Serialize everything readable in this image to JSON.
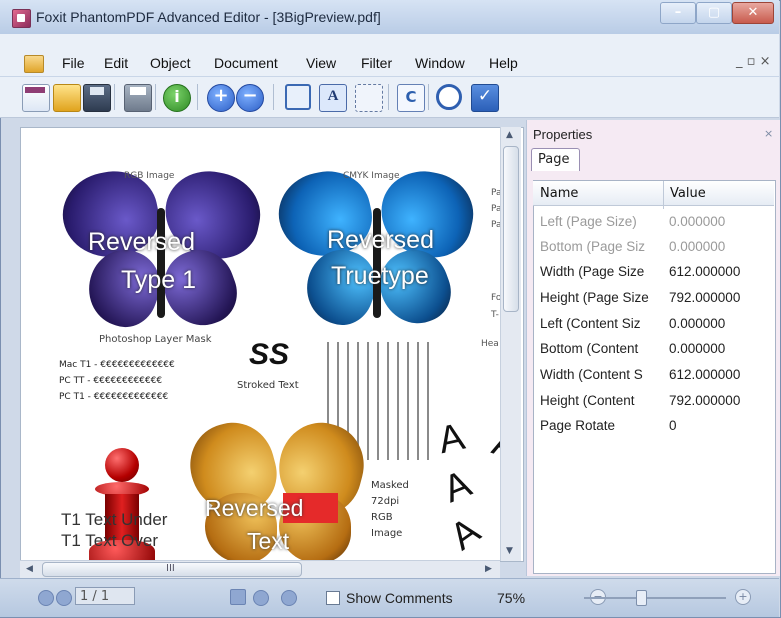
{
  "window": {
    "title": "Foxit PhantomPDF Advanced Editor - [3BigPreview.pdf]",
    "controls": {
      "minimize": "–",
      "maximize": "▢",
      "close": "✕"
    }
  },
  "menubar": {
    "items": [
      "File",
      "Edit",
      "Object",
      "Document",
      "View",
      "Filter",
      "Window",
      "Help"
    ],
    "mdi_controls": "_ ▫ ×"
  },
  "toolbar": {
    "buttons": [
      "new-document-icon",
      "open-folder-icon",
      "save-icon",
      "print-icon",
      "info-icon",
      "zoom-in-icon",
      "zoom-out-icon",
      "crop-icon",
      "text-tool-icon",
      "select-tool-icon",
      "rotate-icon",
      "stop-icon",
      "check-icon"
    ]
  },
  "document": {
    "labels": {
      "rgb_image": "RGB Image",
      "cmyk_image": "CMYK Image",
      "reversed1": "Reversed",
      "type1": "Type 1",
      "reversed2": "Reversed",
      "truetype": "Truetype",
      "layer_mask": "Photoshop Layer Mask",
      "mac_t1": "Mac T1 - €€€€€€€€€€€€€",
      "pc_tt": "PC TT - €€€€€€€€€€€€",
      "pc_t1": "PC T1 - €€€€€€€€€€€€€",
      "ss": "SS",
      "stroked": "Stroked Text",
      "reversed3": "Reversed",
      "text": "Text",
      "masked": "Masked",
      "dpi": "72dpi",
      "rgb": "RGB",
      "image": "Image",
      "t1_under": "T1 Text Under",
      "t1_over": "T1 Text Over",
      "letter_a": "A",
      "edge1": "Par",
      "edge2": "Par",
      "edge3": "Par",
      "edge4": "Fo",
      "edge5": "T-",
      "edge6": "Hea"
    }
  },
  "properties": {
    "title": "Properties",
    "close": "×",
    "tab": "Page",
    "columns": {
      "name": "Name",
      "value": "Value"
    },
    "rows": [
      {
        "name": "Left (Page Size)",
        "value": "0.000000",
        "disabled": true
      },
      {
        "name": "Bottom (Page Siz",
        "value": "0.000000",
        "disabled": true
      },
      {
        "name": "Width (Page Size",
        "value": "612.000000",
        "disabled": false
      },
      {
        "name": "Height (Page Size",
        "value": "792.000000",
        "disabled": false
      },
      {
        "name": "Left (Content Siz",
        "value": "0.000000",
        "disabled": false
      },
      {
        "name": "Bottom (Content",
        "value": "0.000000",
        "disabled": false
      },
      {
        "name": "Width (Content S",
        "value": "612.000000",
        "disabled": false
      },
      {
        "name": "Height (Content",
        "value": "792.000000",
        "disabled": false
      },
      {
        "name": "Page Rotate",
        "value": "0",
        "disabled": false
      }
    ]
  },
  "statusbar": {
    "page": "1 / 1",
    "show_comments": "Show Comments",
    "zoom": "75%",
    "zoom_minus": "−",
    "zoom_plus": "+",
    "scroll_grip": "III"
  }
}
